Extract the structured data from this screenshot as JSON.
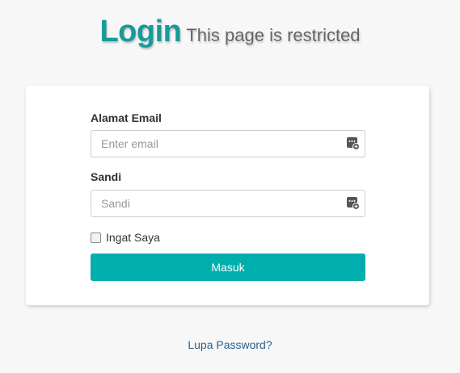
{
  "header": {
    "title": "Login",
    "subtitle": "This page is restricted"
  },
  "form": {
    "email_label": "Alamat Email",
    "email_placeholder": "Enter email",
    "email_value": "",
    "password_label": "Sandi",
    "password_placeholder": "Sandi",
    "password_value": "",
    "remember_label": "Ingat Saya",
    "remember_checked": false,
    "submit_label": "Masuk",
    "password_manager_icon": "password-manager-icon"
  },
  "links": {
    "forgot_password": "Lupa Password?"
  },
  "colors": {
    "accent": "#00aeae",
    "title": "#179a9a",
    "link": "#2a5f8a",
    "background": "#f7f7f7"
  }
}
